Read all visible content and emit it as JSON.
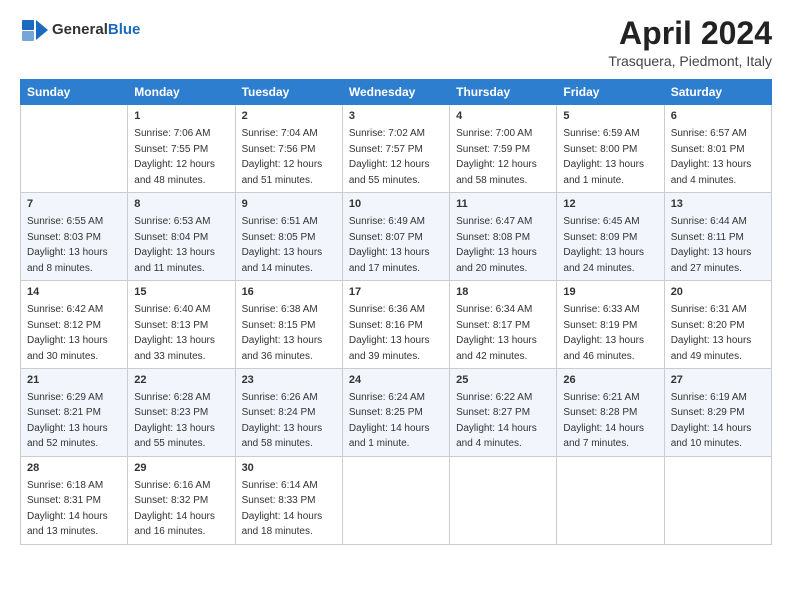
{
  "header": {
    "logo_line1": "General",
    "logo_line2": "Blue",
    "main_title": "April 2024",
    "subtitle": "Trasquera, Piedmont, Italy"
  },
  "days_of_week": [
    "Sunday",
    "Monday",
    "Tuesday",
    "Wednesday",
    "Thursday",
    "Friday",
    "Saturday"
  ],
  "weeks": [
    [
      {
        "num": "",
        "sunrise": "",
        "sunset": "",
        "daylight": ""
      },
      {
        "num": "1",
        "sunrise": "Sunrise: 7:06 AM",
        "sunset": "Sunset: 7:55 PM",
        "daylight": "Daylight: 12 hours and 48 minutes."
      },
      {
        "num": "2",
        "sunrise": "Sunrise: 7:04 AM",
        "sunset": "Sunset: 7:56 PM",
        "daylight": "Daylight: 12 hours and 51 minutes."
      },
      {
        "num": "3",
        "sunrise": "Sunrise: 7:02 AM",
        "sunset": "Sunset: 7:57 PM",
        "daylight": "Daylight: 12 hours and 55 minutes."
      },
      {
        "num": "4",
        "sunrise": "Sunrise: 7:00 AM",
        "sunset": "Sunset: 7:59 PM",
        "daylight": "Daylight: 12 hours and 58 minutes."
      },
      {
        "num": "5",
        "sunrise": "Sunrise: 6:59 AM",
        "sunset": "Sunset: 8:00 PM",
        "daylight": "Daylight: 13 hours and 1 minute."
      },
      {
        "num": "6",
        "sunrise": "Sunrise: 6:57 AM",
        "sunset": "Sunset: 8:01 PM",
        "daylight": "Daylight: 13 hours and 4 minutes."
      }
    ],
    [
      {
        "num": "7",
        "sunrise": "Sunrise: 6:55 AM",
        "sunset": "Sunset: 8:03 PM",
        "daylight": "Daylight: 13 hours and 8 minutes."
      },
      {
        "num": "8",
        "sunrise": "Sunrise: 6:53 AM",
        "sunset": "Sunset: 8:04 PM",
        "daylight": "Daylight: 13 hours and 11 minutes."
      },
      {
        "num": "9",
        "sunrise": "Sunrise: 6:51 AM",
        "sunset": "Sunset: 8:05 PM",
        "daylight": "Daylight: 13 hours and 14 minutes."
      },
      {
        "num": "10",
        "sunrise": "Sunrise: 6:49 AM",
        "sunset": "Sunset: 8:07 PM",
        "daylight": "Daylight: 13 hours and 17 minutes."
      },
      {
        "num": "11",
        "sunrise": "Sunrise: 6:47 AM",
        "sunset": "Sunset: 8:08 PM",
        "daylight": "Daylight: 13 hours and 20 minutes."
      },
      {
        "num": "12",
        "sunrise": "Sunrise: 6:45 AM",
        "sunset": "Sunset: 8:09 PM",
        "daylight": "Daylight: 13 hours and 24 minutes."
      },
      {
        "num": "13",
        "sunrise": "Sunrise: 6:44 AM",
        "sunset": "Sunset: 8:11 PM",
        "daylight": "Daylight: 13 hours and 27 minutes."
      }
    ],
    [
      {
        "num": "14",
        "sunrise": "Sunrise: 6:42 AM",
        "sunset": "Sunset: 8:12 PM",
        "daylight": "Daylight: 13 hours and 30 minutes."
      },
      {
        "num": "15",
        "sunrise": "Sunrise: 6:40 AM",
        "sunset": "Sunset: 8:13 PM",
        "daylight": "Daylight: 13 hours and 33 minutes."
      },
      {
        "num": "16",
        "sunrise": "Sunrise: 6:38 AM",
        "sunset": "Sunset: 8:15 PM",
        "daylight": "Daylight: 13 hours and 36 minutes."
      },
      {
        "num": "17",
        "sunrise": "Sunrise: 6:36 AM",
        "sunset": "Sunset: 8:16 PM",
        "daylight": "Daylight: 13 hours and 39 minutes."
      },
      {
        "num": "18",
        "sunrise": "Sunrise: 6:34 AM",
        "sunset": "Sunset: 8:17 PM",
        "daylight": "Daylight: 13 hours and 42 minutes."
      },
      {
        "num": "19",
        "sunrise": "Sunrise: 6:33 AM",
        "sunset": "Sunset: 8:19 PM",
        "daylight": "Daylight: 13 hours and 46 minutes."
      },
      {
        "num": "20",
        "sunrise": "Sunrise: 6:31 AM",
        "sunset": "Sunset: 8:20 PM",
        "daylight": "Daylight: 13 hours and 49 minutes."
      }
    ],
    [
      {
        "num": "21",
        "sunrise": "Sunrise: 6:29 AM",
        "sunset": "Sunset: 8:21 PM",
        "daylight": "Daylight: 13 hours and 52 minutes."
      },
      {
        "num": "22",
        "sunrise": "Sunrise: 6:28 AM",
        "sunset": "Sunset: 8:23 PM",
        "daylight": "Daylight: 13 hours and 55 minutes."
      },
      {
        "num": "23",
        "sunrise": "Sunrise: 6:26 AM",
        "sunset": "Sunset: 8:24 PM",
        "daylight": "Daylight: 13 hours and 58 minutes."
      },
      {
        "num": "24",
        "sunrise": "Sunrise: 6:24 AM",
        "sunset": "Sunset: 8:25 PM",
        "daylight": "Daylight: 14 hours and 1 minute."
      },
      {
        "num": "25",
        "sunrise": "Sunrise: 6:22 AM",
        "sunset": "Sunset: 8:27 PM",
        "daylight": "Daylight: 14 hours and 4 minutes."
      },
      {
        "num": "26",
        "sunrise": "Sunrise: 6:21 AM",
        "sunset": "Sunset: 8:28 PM",
        "daylight": "Daylight: 14 hours and 7 minutes."
      },
      {
        "num": "27",
        "sunrise": "Sunrise: 6:19 AM",
        "sunset": "Sunset: 8:29 PM",
        "daylight": "Daylight: 14 hours and 10 minutes."
      }
    ],
    [
      {
        "num": "28",
        "sunrise": "Sunrise: 6:18 AM",
        "sunset": "Sunset: 8:31 PM",
        "daylight": "Daylight: 14 hours and 13 minutes."
      },
      {
        "num": "29",
        "sunrise": "Sunrise: 6:16 AM",
        "sunset": "Sunset: 8:32 PM",
        "daylight": "Daylight: 14 hours and 16 minutes."
      },
      {
        "num": "30",
        "sunrise": "Sunrise: 6:14 AM",
        "sunset": "Sunset: 8:33 PM",
        "daylight": "Daylight: 14 hours and 18 minutes."
      },
      {
        "num": "",
        "sunrise": "",
        "sunset": "",
        "daylight": ""
      },
      {
        "num": "",
        "sunrise": "",
        "sunset": "",
        "daylight": ""
      },
      {
        "num": "",
        "sunrise": "",
        "sunset": "",
        "daylight": ""
      },
      {
        "num": "",
        "sunrise": "",
        "sunset": "",
        "daylight": ""
      }
    ]
  ]
}
